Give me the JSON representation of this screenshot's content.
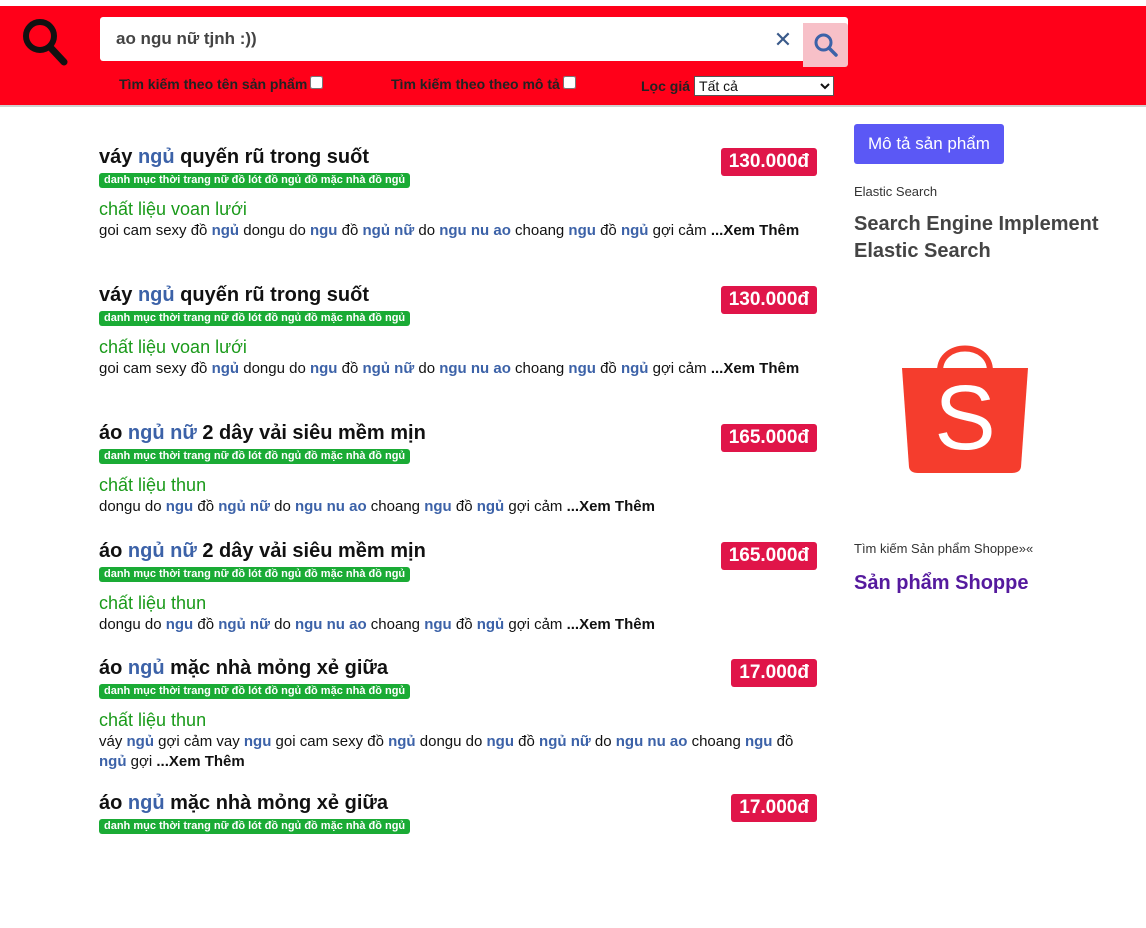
{
  "search": {
    "query": "ao ngu nữ tjnh :))",
    "clear_icon": "✕"
  },
  "filters": {
    "by_name_label": "Tìm kiếm theo tên sản phẩm",
    "by_desc_label": "Tìm kiếm theo theo mô tả",
    "price_label": "Lọc giá",
    "price_selected": "Tất cả"
  },
  "colors": {
    "topbar": "#ff0019",
    "price_badge": "#e01549",
    "category_badge": "#1aab35",
    "highlight": "#3c62a8",
    "material": "#1a9a1a",
    "desc_button": "#5b58f5"
  },
  "results": [
    {
      "title": [
        {
          "t": "váy "
        },
        {
          "t": "ngủ",
          "hl": true
        },
        {
          "t": " quyến rũ trong suốt"
        }
      ],
      "price": "130.000đ",
      "category": "danh mục thời trang nữ đồ lót đồ ngủ đồ mặc nhà đồ ngủ",
      "material": "chất liệu voan lưới",
      "desc": [
        {
          "t": "goi cam sexy đồ "
        },
        {
          "t": "ngủ",
          "hl": true
        },
        {
          "t": " dongu do "
        },
        {
          "t": "ngu",
          "hl": true
        },
        {
          "t": " đồ "
        },
        {
          "t": "ngủ nữ",
          "hl": true
        },
        {
          "t": " do "
        },
        {
          "t": "ngu nu ao",
          "hl": true
        },
        {
          "t": " choang "
        },
        {
          "t": "ngu",
          "hl": true
        },
        {
          "t": " đồ "
        },
        {
          "t": "ngủ",
          "hl": true
        },
        {
          "t": " gợi cảm "
        },
        {
          "t": "...Xem Thêm",
          "more": true
        }
      ]
    },
    {
      "title": [
        {
          "t": "váy "
        },
        {
          "t": "ngủ",
          "hl": true
        },
        {
          "t": " quyến rũ trong suốt"
        }
      ],
      "price": "130.000đ",
      "category": "danh mục thời trang nữ đồ lót đồ ngủ đồ mặc nhà đồ ngủ",
      "material": "chất liệu voan lưới",
      "desc": [
        {
          "t": "goi cam sexy đồ "
        },
        {
          "t": "ngủ",
          "hl": true
        },
        {
          "t": " dongu do "
        },
        {
          "t": "ngu",
          "hl": true
        },
        {
          "t": " đồ "
        },
        {
          "t": "ngủ nữ",
          "hl": true
        },
        {
          "t": " do "
        },
        {
          "t": "ngu nu ao",
          "hl": true
        },
        {
          "t": " choang "
        },
        {
          "t": "ngu",
          "hl": true
        },
        {
          "t": " đồ "
        },
        {
          "t": "ngủ",
          "hl": true
        },
        {
          "t": " gợi cảm "
        },
        {
          "t": "...Xem Thêm",
          "more": true
        }
      ]
    },
    {
      "title": [
        {
          "t": "áo "
        },
        {
          "t": "ngủ nữ",
          "hl": true
        },
        {
          "t": " 2 dây vải siêu mềm mịn"
        }
      ],
      "price": "165.000đ",
      "category": "danh mục thời trang nữ đồ lót đồ ngủ đồ mặc nhà đồ ngủ",
      "material": "chất liệu thun",
      "desc": [
        {
          "t": "dongu do "
        },
        {
          "t": "ngu",
          "hl": true
        },
        {
          "t": " đồ "
        },
        {
          "t": "ngủ nữ",
          "hl": true
        },
        {
          "t": " do "
        },
        {
          "t": "ngu nu ao",
          "hl": true
        },
        {
          "t": " choang "
        },
        {
          "t": "ngu",
          "hl": true
        },
        {
          "t": " đồ "
        },
        {
          "t": "ngủ",
          "hl": true
        },
        {
          "t": " gợi cảm "
        },
        {
          "t": "...Xem Thêm",
          "more": true
        }
      ]
    },
    {
      "title": [
        {
          "t": "áo "
        },
        {
          "t": "ngủ nữ",
          "hl": true
        },
        {
          "t": " 2 dây vải siêu mềm mịn"
        }
      ],
      "price": "165.000đ",
      "category": "danh mục thời trang nữ đồ lót đồ ngủ đồ mặc nhà đồ ngủ",
      "material": "chất liệu thun",
      "desc": [
        {
          "t": "dongu do "
        },
        {
          "t": "ngu",
          "hl": true
        },
        {
          "t": " đồ "
        },
        {
          "t": "ngủ nữ",
          "hl": true
        },
        {
          "t": " do "
        },
        {
          "t": "ngu nu ao",
          "hl": true
        },
        {
          "t": " choang "
        },
        {
          "t": "ngu",
          "hl": true
        },
        {
          "t": " đồ "
        },
        {
          "t": "ngủ",
          "hl": true
        },
        {
          "t": " gợi cảm "
        },
        {
          "t": "...Xem Thêm",
          "more": true
        }
      ]
    },
    {
      "title": [
        {
          "t": "áo "
        },
        {
          "t": "ngủ",
          "hl": true
        },
        {
          "t": " mặc nhà mỏng xẻ giữa"
        }
      ],
      "price": "17.000đ",
      "category": "danh mục thời trang nữ đồ lót đồ ngủ đồ mặc nhà đồ ngủ",
      "material": "chất liệu thun",
      "desc": [
        {
          "t": "váy "
        },
        {
          "t": "ngủ",
          "hl": true
        },
        {
          "t": " gợi cảm vay "
        },
        {
          "t": "ngu",
          "hl": true
        },
        {
          "t": " goi cam sexy đồ "
        },
        {
          "t": "ngủ",
          "hl": true
        },
        {
          "t": " dongu do "
        },
        {
          "t": "ngu",
          "hl": true
        },
        {
          "t": " đồ "
        },
        {
          "t": "ngủ nữ",
          "hl": true
        },
        {
          "t": " do "
        },
        {
          "t": "ngu nu ao",
          "hl": true
        },
        {
          "t": " choang "
        },
        {
          "t": "ngu",
          "hl": true
        },
        {
          "t": " đồ "
        },
        {
          "t": "ngủ",
          "hl": true
        },
        {
          "t": " gợi "
        },
        {
          "t": "...Xem Thêm",
          "more": true
        }
      ]
    },
    {
      "title": [
        {
          "t": "áo "
        },
        {
          "t": "ngủ",
          "hl": true
        },
        {
          "t": " mặc nhà mỏng xẻ giữa"
        }
      ],
      "price": "17.000đ",
      "category": "danh mục thời trang nữ đồ lót đồ ngủ đồ mặc nhà đồ ngủ",
      "material": "",
      "desc": []
    }
  ],
  "sidebar": {
    "desc_button": "Mô tả sản phẩm",
    "es_label": "Elastic Search",
    "es_title": "Search Engine Implement Elastic Search",
    "shopee_logo_letter": "S",
    "shopee_label": "Tìm kiếm Sản phẩm Shoppe»«",
    "shopee_link": "Sản phẩm Shoppe"
  }
}
